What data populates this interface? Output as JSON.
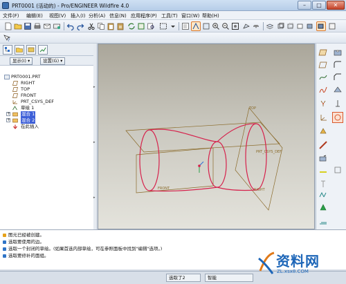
{
  "window": {
    "title": "PRT0001 (活动的) - Pro/ENGINEER Wildfire 4.0",
    "buttons": {
      "minimize": "–",
      "maximize": "□",
      "close": "✕"
    }
  },
  "menubar": {
    "items": [
      "文件(F)",
      "编辑(E)",
      "视图(V)",
      "插入(I)",
      "分析(A)",
      "信息(N)",
      "应用程序(P)",
      "工具(T)",
      "窗口(W)",
      "帮助(H)"
    ]
  },
  "left_panel": {
    "show_button": "显示(I) ▾",
    "settings_button": "设置(G) ▾",
    "tree": [
      {
        "label": "PRT0001.PRT",
        "icon": "part-icon"
      },
      {
        "label": "RIGHT",
        "icon": "datum-plane-icon"
      },
      {
        "label": "TOP",
        "icon": "datum-plane-icon"
      },
      {
        "label": "FRONT",
        "icon": "datum-plane-icon"
      },
      {
        "label": "PRT_CSYS_DEF",
        "icon": "csys-icon"
      },
      {
        "label": "草绘 1",
        "icon": "sketch-icon"
      },
      {
        "label": "混合 1",
        "icon": "blend-icon",
        "highlighted": true
      },
      {
        "label": "混合 2",
        "icon": "blend-icon",
        "highlighted": true
      },
      {
        "label": "在此插入",
        "icon": "insert-here-icon"
      }
    ]
  },
  "graphics": {
    "datum_labels": {
      "top": "TOP",
      "right": "RIGHT",
      "front": "FRONT",
      "csys": "PRT_CSYS_DEF"
    }
  },
  "messages": [
    {
      "text": "图元已经被创建。",
      "kind": "warn"
    },
    {
      "text": "选取要使用的边。",
      "kind": "info"
    },
    {
      "text": "选取一个封闭的草绘。(如果首选内部草绘，可在参照面板中找到\"编辑\"选项。)",
      "kind": "info"
    },
    {
      "text": "选取要修补的面组。",
      "kind": "info"
    }
  ],
  "statusbar": {
    "selected": "选取了2",
    "filter": "智能"
  },
  "watermark": {
    "brand": "资料网",
    "url": "ZL.xsx8.COM"
  },
  "colors": {
    "model": "#d6204b",
    "datum": "#8a6a2a",
    "selection": "#3d5fd8",
    "active_tool": "#d9572b"
  }
}
